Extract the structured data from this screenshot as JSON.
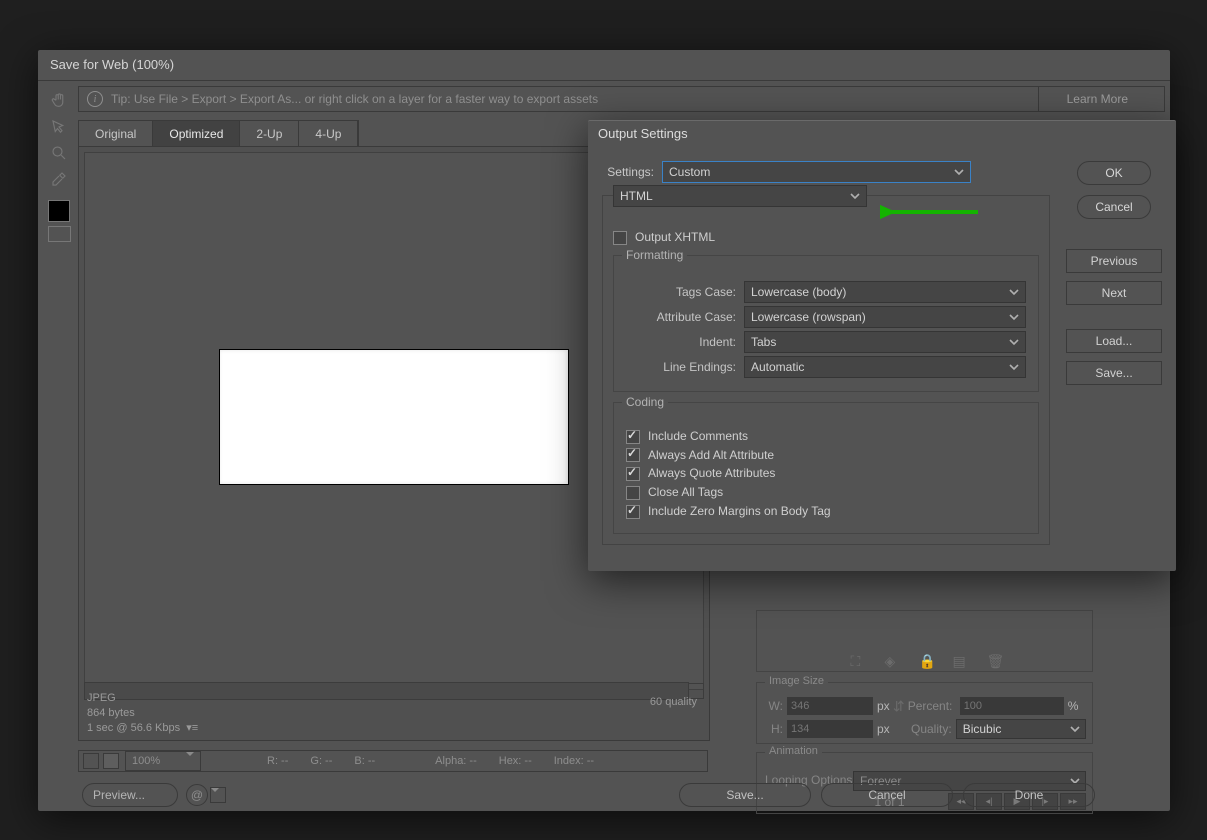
{
  "window": {
    "title": "Save for Web (100%)"
  },
  "tip": {
    "text": "Tip: Use File > Export > Export As...   or right click on a layer for a faster way to export assets",
    "learn": "Learn More"
  },
  "tabs": [
    "Original",
    "Optimized",
    "2-Up",
    "4-Up"
  ],
  "canvas": {
    "format": "JPEG",
    "bytes": "864 bytes",
    "speed": "1 sec @ 56.6 Kbps",
    "quality": "60 quality"
  },
  "footer": {
    "zoom": "100%",
    "R": "R: --",
    "G": "G: --",
    "B": "B: --",
    "alpha": "Alpha: --",
    "hex": "Hex: --",
    "index": "Index: --",
    "preview": "Preview...",
    "save": "Save...",
    "cancel": "Cancel",
    "done": "Done"
  },
  "imageSize": {
    "title": "Image Size",
    "wLabel": "W:",
    "w": "346",
    "hLabel": "H:",
    "h": "134",
    "px": "px",
    "percentLabel": "Percent:",
    "percent": "100",
    "pct": "%",
    "qualityLabel": "Quality:",
    "quality": "Bicubic"
  },
  "animation": {
    "title": "Animation",
    "loopLabel": "Looping Options:",
    "loop": "Forever",
    "pager": "1 of 1"
  },
  "out": {
    "title": "Output Settings",
    "settingsLabel": "Settings:",
    "settings": "Custom",
    "section": "HTML",
    "xhtml": "Output XHTML",
    "formatting": "Formatting",
    "tagsLabel": "Tags Case:",
    "tags": "Lowercase (body)",
    "attrLabel": "Attribute Case:",
    "attr": "Lowercase (rowspan)",
    "indentLabel": "Indent:",
    "indent": "Tabs",
    "lineLabel": "Line Endings:",
    "line": "Automatic",
    "coding": "Coding",
    "c1": "Include Comments",
    "c2": "Always Add Alt Attribute",
    "c3": "Always Quote Attributes",
    "c4": "Close All Tags",
    "c5": "Include Zero Margins on Body Tag",
    "ok": "OK",
    "cancel": "Cancel",
    "prev": "Previous",
    "next": "Next",
    "load": "Load...",
    "save": "Save..."
  }
}
